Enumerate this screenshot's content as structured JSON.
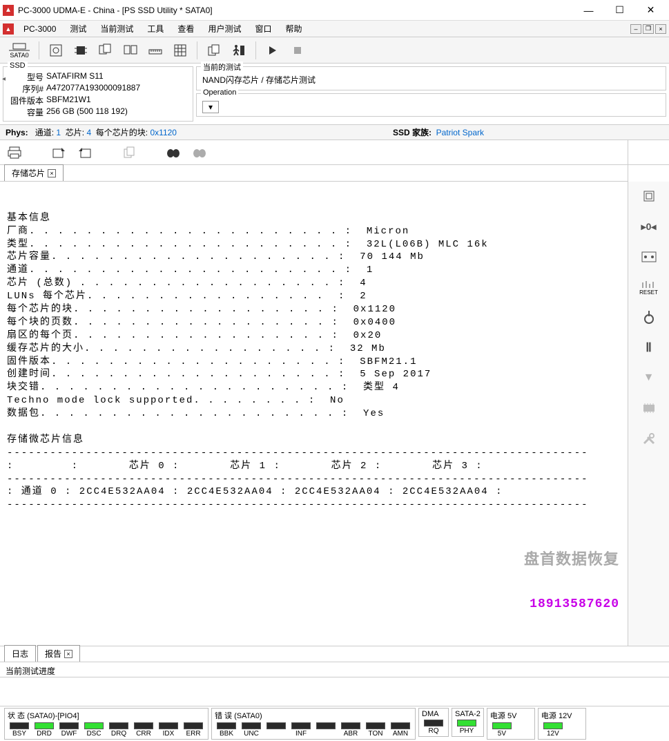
{
  "window": {
    "title": "PC-3000 UDMA-E - China - [PS SSD Utility * SATA0]",
    "app_short": "PC-3000"
  },
  "menu": {
    "items": [
      "测试",
      "当前测试",
      "工具",
      "查看",
      "用户测试",
      "窗口",
      "帮助"
    ]
  },
  "ssd_panel": {
    "legend": "SSD",
    "model_label": "型号",
    "model": "SATAFIRM    S11",
    "serial_label": "序列#",
    "serial": "A472077A193000091887",
    "fw_label": "固件版本",
    "fw": "SBFM21W1",
    "cap_label": "容量",
    "cap": "256 GB (500 118 192)"
  },
  "current_test": {
    "legend": "当前的测试",
    "text": "NAND闪存芯片 / 存储芯片测试"
  },
  "operation": {
    "legend": "Operation"
  },
  "phys": {
    "label": "Phys:",
    "channel_label": "通道:",
    "channel": "1",
    "chip_label": "芯片:",
    "chip": "4",
    "blocks_label": "每个芯片的块:",
    "blocks": "0x1120",
    "ssd_family_label": "SSD 家族:",
    "ssd_family": "Patriot Spark"
  },
  "tabs": {
    "report_tab": "存储芯片"
  },
  "content_lines": [
    "基本信息",
    "厂商. . . . . . . . . . . . . . . . . . . . . . :  Micron",
    "类型. . . . . . . . . . . . . . . . . . . . . . :  32L(L06B) MLC 16k",
    "芯片容量. . . . . . . . . . . . . . . . . . . . :  70 144 Mb",
    "通道. . . . . . . . . . . . . . . . . . . . . . :  1",
    "芯片 (总数) . . . . . . . . . . . . . . . . . . :  4",
    "LUNs 每个芯片. . . . . . . . . . . . . . . . .  :  2",
    "每个芯片的块. . . . . . . . . . . . . . . . . . :  0x1120",
    "每个块的页数. . . . . . . . . . . . . . . . . . :  0x0400",
    "扇区的每个页. . . . . . . . . . . . . . . . . . :  0x20",
    "缓存芯片的大小. . . . . . . . . . . . . . . . . :  32 Mb",
    "固件版本. . . . . . . . . . . . . . . . . . . . :  SBFM21.1",
    "创建时间. . . . . . . . . . . . . . . . . . . . :  5 Sep 2017",
    "块交错. . . . . . . . . . . . . . . . . . . . . :  类型 4",
    "Techno mode lock supported. . . . . . . . :  No",
    "数据包. . . . . . . . . . . . . . . . . . . . . :  Yes",
    "",
    "存储微芯片信息",
    "---------------------------------------------------------------------------------",
    ":        :       芯片 0 :       芯片 1 :       芯片 2 :       芯片 3 :",
    "---------------------------------------------------------------------------------",
    ": 通道 0 : 2CC4E532AA04 : 2CC4E532AA04 : 2CC4E532AA04 : 2CC4E532AA04 :",
    "---------------------------------------------------------------------------------"
  ],
  "watermark": {
    "line1": "盘首数据恢复",
    "line2": "18913587620"
  },
  "bottom_tabs": {
    "log": "日志",
    "report": "报告"
  },
  "progress": {
    "label": "当前测试进度"
  },
  "status": {
    "g1_title": "状 态 (SATA0)-[PIO4]",
    "g1": [
      {
        "label": "BSY",
        "on": false
      },
      {
        "label": "DRD",
        "on": true
      },
      {
        "label": "DWF",
        "on": false
      },
      {
        "label": "DSC",
        "on": true
      },
      {
        "label": "DRQ",
        "on": false
      },
      {
        "label": "CRR",
        "on": false
      },
      {
        "label": "IDX",
        "on": false
      },
      {
        "label": "ERR",
        "on": false
      }
    ],
    "g2_title": "错 误 (SATA0)",
    "g2": [
      {
        "label": "BBK",
        "on": false
      },
      {
        "label": "UNC",
        "on": false
      },
      {
        "label": "",
        "on": false
      },
      {
        "label": "INF",
        "on": false
      },
      {
        "label": "",
        "on": false
      },
      {
        "label": "ABR",
        "on": false
      },
      {
        "label": "TON",
        "on": false
      },
      {
        "label": "AMN",
        "on": false
      }
    ],
    "g3_title": "DMA",
    "g3": [
      {
        "label": "RQ",
        "on": false
      }
    ],
    "g4_title": "SATA-2",
    "g4": [
      {
        "label": "PHY",
        "on": true
      }
    ],
    "g5_title": "电源 5V",
    "g5": [
      {
        "label": "5V",
        "on": true
      }
    ],
    "g6_title": "电源 12V",
    "g6": [
      {
        "label": "12V",
        "on": true
      }
    ]
  },
  "sidebar_reset": "RESET"
}
